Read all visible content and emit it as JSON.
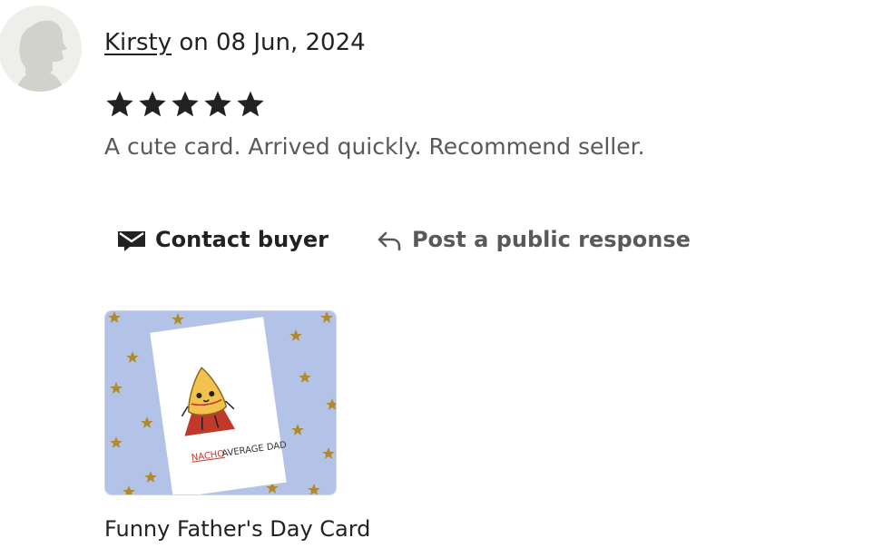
{
  "review": {
    "reviewer_name": "Kirsty",
    "date_text": "on 08 Jun, 2024",
    "rating": 5,
    "max_rating": 5,
    "text": "A cute card. Arrived quickly. Recommend seller.",
    "actions": {
      "contact_label": "Contact buyer",
      "respond_label": "Post a public response"
    },
    "product": {
      "title": "Funny Father's Day Card",
      "image_text_1": "NACHO",
      "image_text_2": "AVERAGE DAD"
    }
  },
  "icons": {
    "avatar": "user-silhouette-icon",
    "star": "star-icon",
    "contact": "envelope-icon",
    "respond": "reply-arrow-icon"
  },
  "colors": {
    "text": "#222222",
    "muted": "#595959",
    "card_background": "#b3c3e8",
    "accent_red": "#c0392b"
  }
}
